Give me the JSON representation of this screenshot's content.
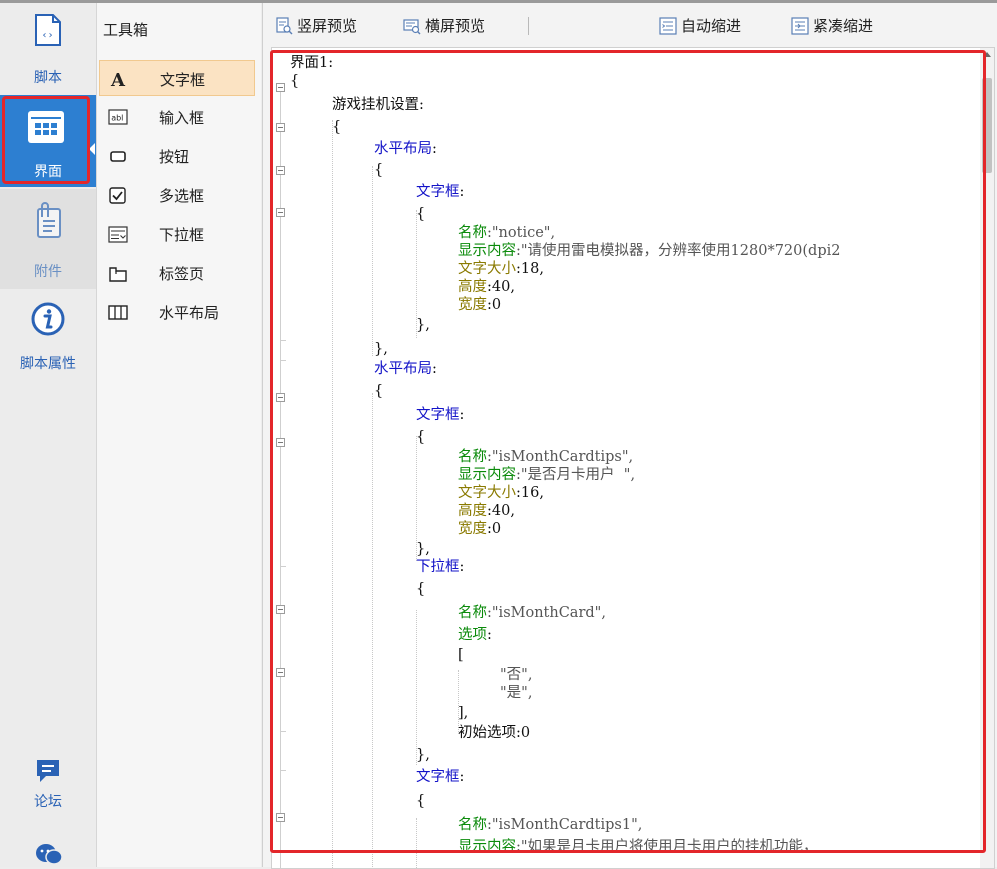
{
  "left_nav": {
    "script_label": "脚本",
    "ui_label": "界面",
    "attach_label": "附件",
    "props_label": "脚本属性",
    "forum_label": "论坛"
  },
  "toolbox": {
    "title": "工具箱",
    "items": [
      {
        "label": "文字框",
        "icon": "text-a-icon"
      },
      {
        "label": "输入框",
        "icon": "input-abl-icon"
      },
      {
        "label": "按钮",
        "icon": "button-rect-icon"
      },
      {
        "label": "多选框",
        "icon": "checkbox-icon"
      },
      {
        "label": "下拉框",
        "icon": "dropdown-icon"
      },
      {
        "label": "标签页",
        "icon": "tab-page-icon"
      },
      {
        "label": "水平布局",
        "icon": "horizontal-layout-icon"
      }
    ]
  },
  "toolbar": {
    "portrait_preview": "竖屏预览",
    "landscape_preview": "横屏预览",
    "auto_indent": "自动缩进",
    "compact_indent": "紧凑缩进"
  },
  "code": {
    "l1": "界面1:",
    "l2": "{",
    "l3": "游戏挂机设置:",
    "l4": "{",
    "l5": "水平布局",
    "l5c": ":",
    "l6": "{",
    "l7": "文字框",
    "l7c": ":",
    "l8": "{",
    "l9k": "名称",
    "l9v": ":\"notice\",",
    "l10k": "显示内容",
    "l10v": ":\"请使用雷电模拟器，分辨率使用1280*720(dpi2",
    "l11k": "文字大小",
    "l11v": ":18,",
    "l12k": "高度",
    "l12v": ":40,",
    "l13k": "宽度",
    "l13v": ":0",
    "l14": "},",
    "l15": "},",
    "l16": "水平布局",
    "l16c": ":",
    "l17": "{",
    "l18": "文字框",
    "l18c": ":",
    "l19": "{",
    "l20k": "名称",
    "l20v": ":\"isMonthCardtips\",",
    "l21k": "显示内容",
    "l21v": ":\"是否月卡用户  \",",
    "l22k": "文字大小",
    "l22v": ":16,",
    "l23k": "高度",
    "l23v": ":40,",
    "l24k": "宽度",
    "l24v": ":0",
    "l25": "},",
    "l26": "下拉框",
    "l26c": ":",
    "l27": "{",
    "l28k": "名称",
    "l28v": ":\"isMonthCard\",",
    "l29k": "选项",
    "l29v": ":",
    "l30": "[",
    "l31": "\"否\",",
    "l32": "\"是\",",
    "l33": "],",
    "l34": "初始选项:0",
    "l35": "},",
    "l36": "文字框",
    "l36c": ":",
    "l37": "{",
    "l38k": "名称",
    "l38v": ":\"isMonthCardtips1\",",
    "l39k": "显示内容",
    "l39v": ":\"如果是月卡用户将使用月卡用户的挂机功能，"
  }
}
